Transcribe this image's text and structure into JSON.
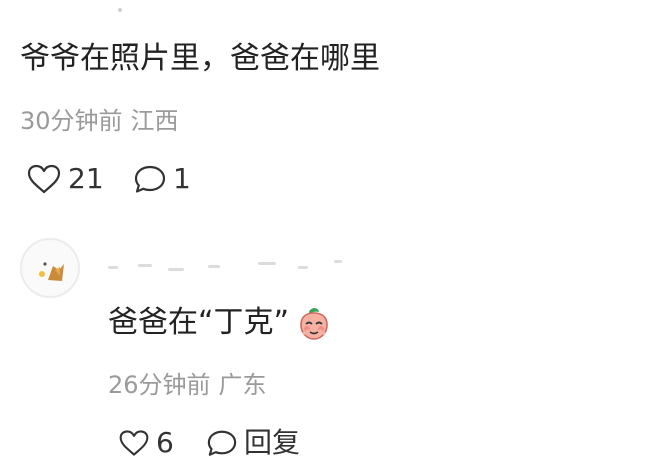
{
  "comment": {
    "text": "爷爷在照片里，爸爸在哪里",
    "time": "30分钟前",
    "location": "江西",
    "likes": "21",
    "replies": "1"
  },
  "reply": {
    "text": "爸爸在“丁克”",
    "emoji_icon": "peach-shy-emoji",
    "time": "26分钟前",
    "location": "广东",
    "likes": "6",
    "reply_label": "回复"
  },
  "icons": {
    "like": "heart-outline-icon",
    "reply": "speech-bubble-icon"
  }
}
